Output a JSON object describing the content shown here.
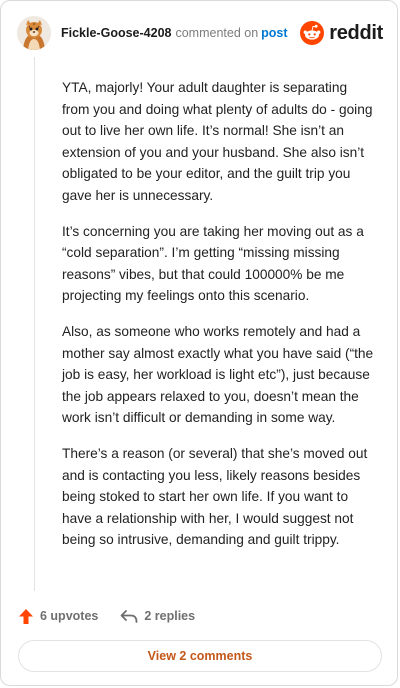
{
  "header": {
    "author": "Fickle-Goose-4208",
    "commented_on": "commented on",
    "post_link": "post",
    "brand": "reddit"
  },
  "comment": {
    "paragraphs": [
      "YTA, majorly! Your adult daughter is separating from you and doing what plenty of adults do - going out to live her own life. It’s normal! She isn’t an extension of you and your husband. She also isn’t obligated to be your editor, and the guilt trip you gave her is unnecessary.",
      "It’s concerning you are taking her moving out as a “cold separation”. I’m getting “missing missing reasons” vibes, but that could 100000% be me projecting my feelings onto this scenario.",
      "Also, as someone who works remotely and had a mother say almost exactly what you have said (“the job is easy, her workload is light etc”), just because the job appears relaxed to you, doesn’t mean the work isn’t difficult or demanding in some way.",
      "There’s a reason (or several) that she’s moved out and is contacting you less, likely reasons besides being stoked to start her own life. If you want to have a relationship with her, I would suggest not being so intrusive, demanding and guilt trippy."
    ]
  },
  "actions": {
    "upvotes": "6 upvotes",
    "replies": "2 replies"
  },
  "footer": {
    "view_comments": "View 2 comments"
  },
  "icons": {
    "upvote": "upvote-arrow-icon",
    "reply": "reply-arrow-icon",
    "avatar": "snoo-avatar",
    "brand": "reddit-logo-icon"
  },
  "colors": {
    "upvote": "#ff4500",
    "link": "#0079d3",
    "view_comments": "#c4581b",
    "brand": "#ff4500"
  }
}
